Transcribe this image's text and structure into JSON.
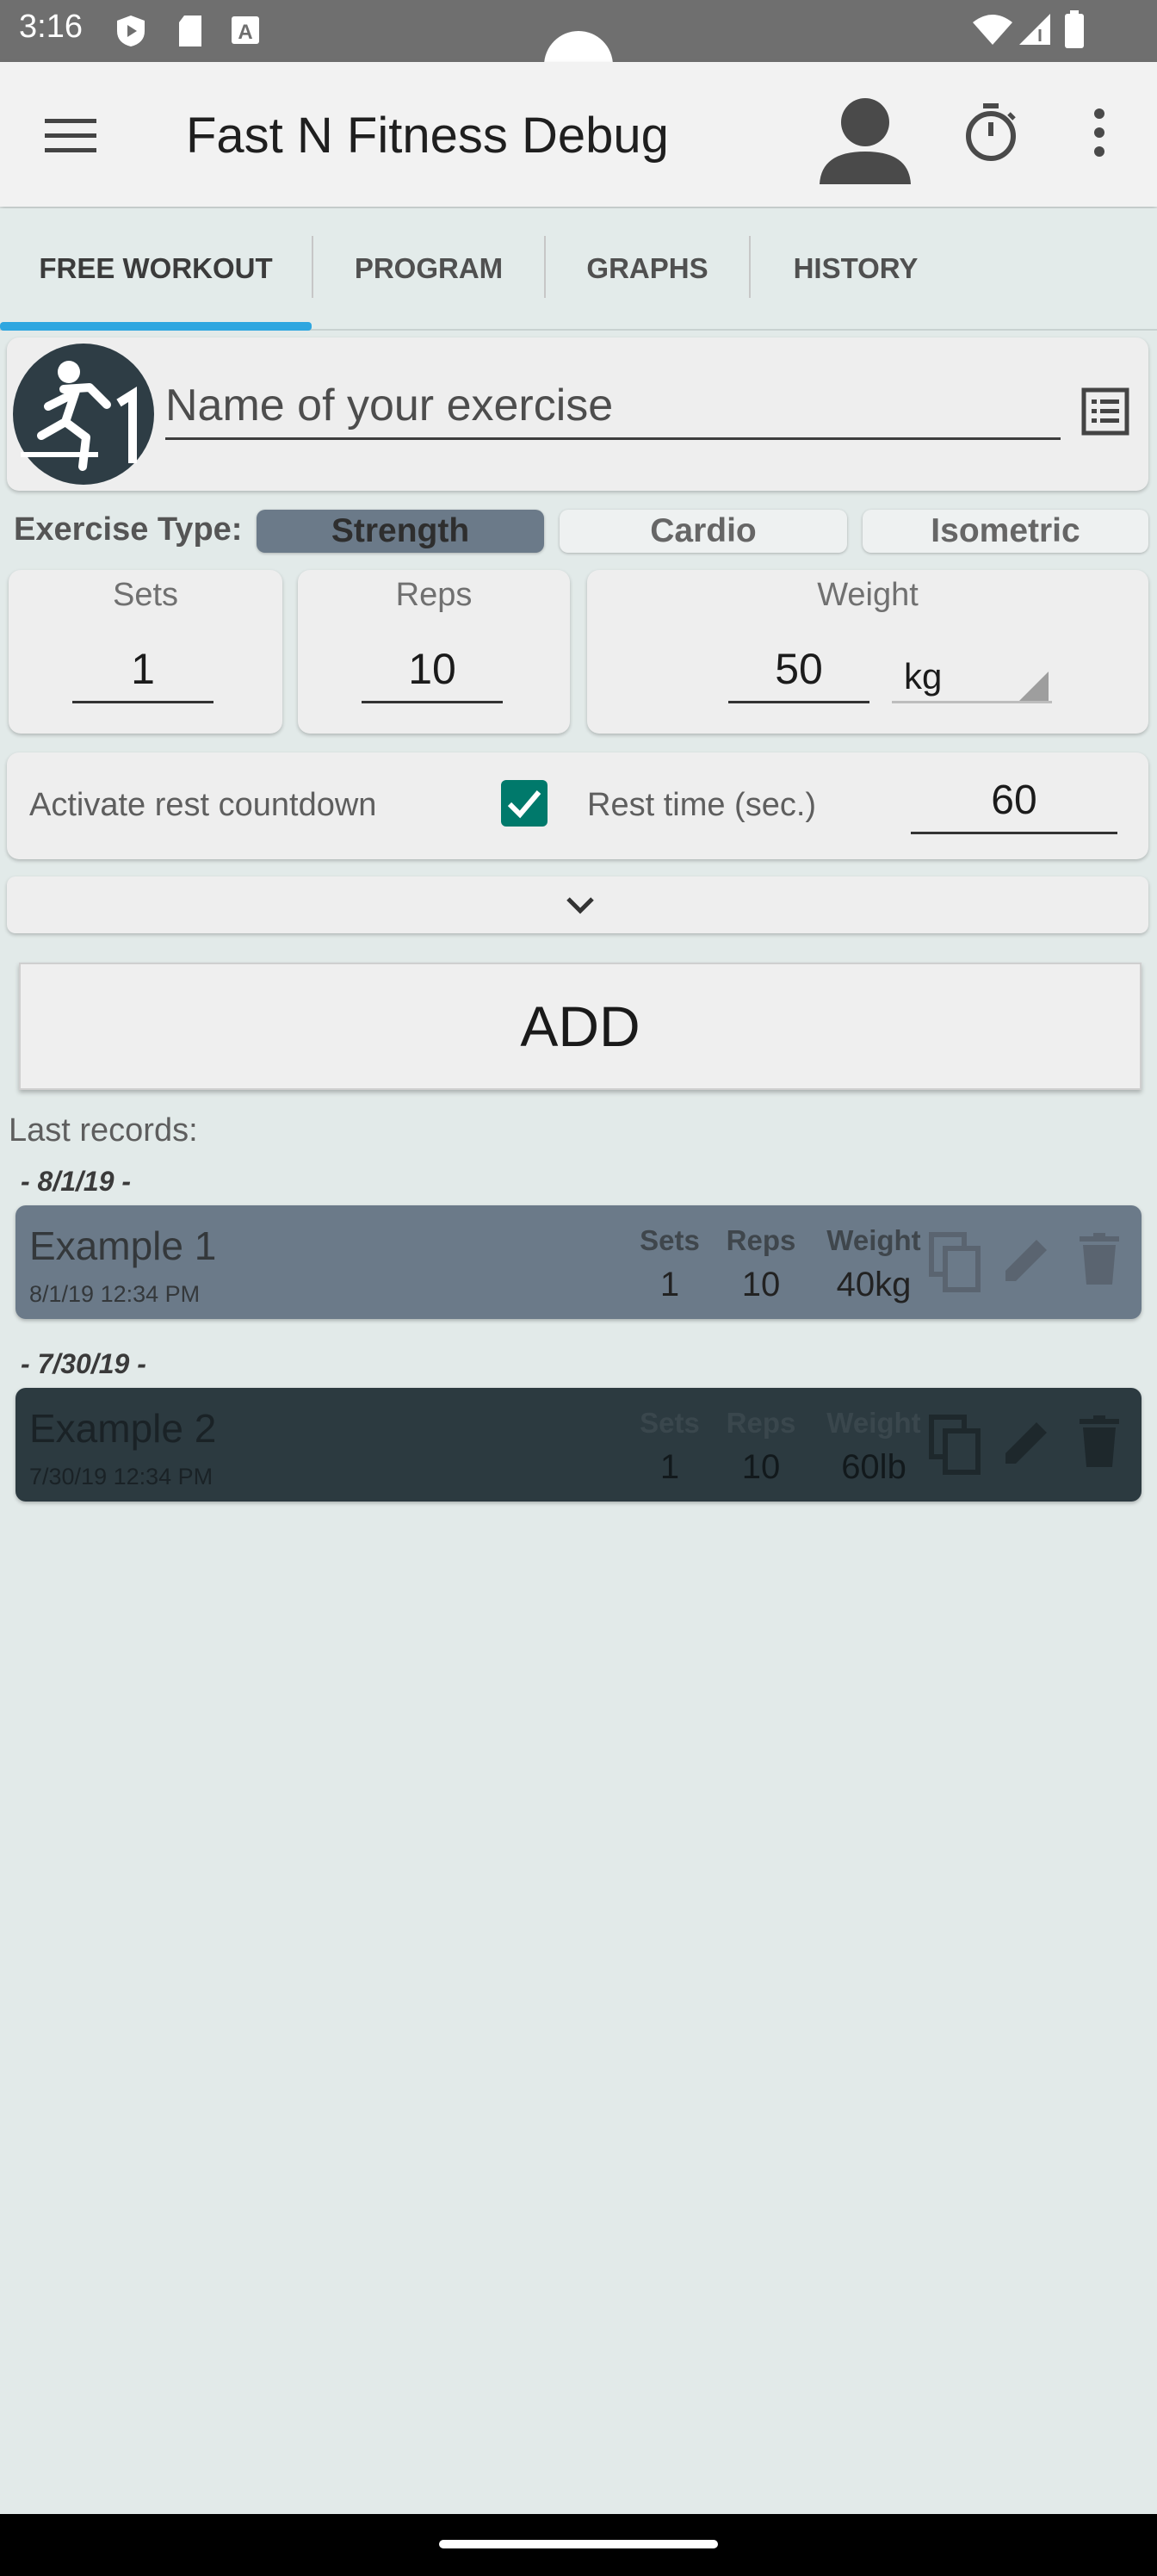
{
  "status_bar": {
    "time": "3:16"
  },
  "app_bar": {
    "title": "Fast N Fitness Debug"
  },
  "tabs": [
    {
      "label": "FREE WORKOUT"
    },
    {
      "label": "PROGRAM"
    },
    {
      "label": "GRAPHS"
    },
    {
      "label": "HISTORY"
    }
  ],
  "exercise": {
    "name_placeholder": "Name of your exercise"
  },
  "exercise_type": {
    "label": "Exercise Type:",
    "options": [
      "Strength",
      "Cardio",
      "Isometric"
    ],
    "selected": "Strength"
  },
  "inputs": {
    "sets_label": "Sets",
    "sets_value": "1",
    "reps_label": "Reps",
    "reps_value": "10",
    "weight_label": "Weight",
    "weight_value": "50",
    "unit": "kg"
  },
  "rest": {
    "label": "Activate rest countdown",
    "checked": true,
    "time_label": "Rest time (sec.)",
    "time_value": "60"
  },
  "add_button": "ADD",
  "last_records_label": "Last records:",
  "records": [
    {
      "date_header": "- 8/1/19 -",
      "name": "Example 1",
      "datetime": "8/1/19  12:34 PM",
      "sets_label": "Sets",
      "reps_label": "Reps",
      "weight_label": "Weight",
      "sets": "1",
      "reps": "10",
      "weight": "40kg"
    },
    {
      "date_header": "- 7/30/19 -",
      "name": "Example 2",
      "datetime": "7/30/19  12:34 PM",
      "sets_label": "Sets",
      "reps_label": "Reps",
      "weight_label": "Weight",
      "sets": "1",
      "reps": "10",
      "weight": "60lb"
    }
  ],
  "colors": {
    "accent": "#2ea6e0",
    "checkbox": "#00796b",
    "selected_segment": "#6b7a89",
    "record1": "#6b7a89",
    "record2": "#2c3a40",
    "background": "#e2eae9"
  }
}
